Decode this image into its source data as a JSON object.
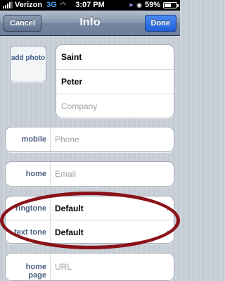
{
  "status_bar": {
    "carrier": "Verizon",
    "network": "3G",
    "time": "3:07 PM",
    "battery": "59%",
    "icons": [
      "signal-icon",
      "wifi-icon",
      "location-icon",
      "alarm-icon",
      "battery-icon"
    ]
  },
  "nav": {
    "title": "Info",
    "cancel_label": "Cancel",
    "done_label": "Done"
  },
  "photo": {
    "label": "add photo"
  },
  "name_fields": {
    "first": "Saint",
    "last": "Peter",
    "company_placeholder": "Company"
  },
  "fields": {
    "mobile_label": "mobile",
    "phone_placeholder": "Phone",
    "home_label": "home",
    "email_placeholder": "Email",
    "ringtone_label": "ringtone",
    "ringtone_value": "Default",
    "text_tone_label": "text tone",
    "text_tone_value": "Default",
    "home_page_label": "home page",
    "url_placeholder": "URL"
  },
  "colors": {
    "annotation_ellipse": "#8a1219",
    "label_blue": "#4b5f82",
    "done_blue": "#1f5fd8"
  }
}
